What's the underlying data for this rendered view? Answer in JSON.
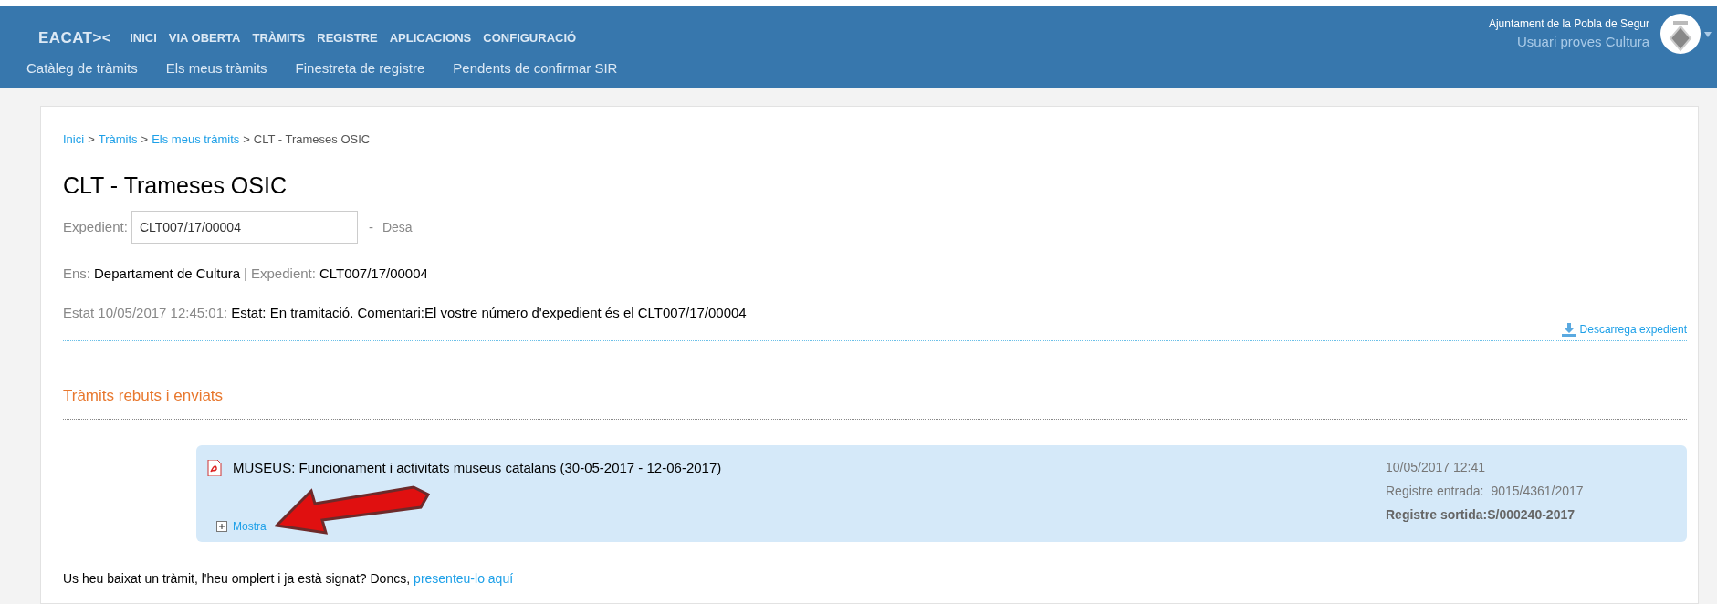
{
  "header": {
    "logo": "EACAT><",
    "nav": [
      {
        "label": "INICI"
      },
      {
        "label": "VIA OBERTA"
      },
      {
        "label": "TRÀMITS"
      },
      {
        "label": "REGISTRE"
      },
      {
        "label": "APLICACIONS"
      },
      {
        "label": "CONFIGURACIÓ"
      }
    ],
    "subnav": [
      {
        "label": "Catàleg de tràmits"
      },
      {
        "label": "Els meus tràmits"
      },
      {
        "label": "Finestreta de registre"
      },
      {
        "label": "Pendents de confirmar SIR"
      }
    ],
    "organization": "Ajuntament de la Pobla de Segur",
    "user": "Usuari proves Cultura"
  },
  "breadcrumb": {
    "links": [
      "Inici",
      "Tràmits",
      "Els meus tràmits"
    ],
    "separator": ">",
    "current": "CLT - Trameses OSIC"
  },
  "title": "CLT - Trameses OSIC",
  "expedient_field": {
    "label": "Expedient:",
    "value": "CLT007/17/00004",
    "separator": "-",
    "save": "Desa"
  },
  "info": {
    "ens_label": "Ens:",
    "ens": "Departament de Cultura",
    "divider": "|",
    "expedient_label": "Expedient:",
    "expedient": "CLT007/17/00004"
  },
  "status": {
    "label": "Estat 10/05/2017 12:45:01:",
    "text": "Estat: En tramitació. Comentari:El vostre número d'expedient és el CLT007/17/00004"
  },
  "download": "Descarrega expedient",
  "section_title": "Tràmits rebuts i enviats",
  "items": [
    {
      "title": "MUSEUS: Funcionament i activitats museus catalans (30-05-2017 - 12-06-2017)",
      "date": "10/05/2017 12:41",
      "entry_label": "Registre entrada:",
      "entry": "9015/4361/2017",
      "exit": "Registre sortida:S/000240-2017",
      "toggle": "Mostra",
      "expanded": false
    }
  ],
  "footer": {
    "text": "Us heu baixat un tràmit, l'heu omplert i ja està signat? Doncs,",
    "link": "presenteu-lo aquí"
  }
}
